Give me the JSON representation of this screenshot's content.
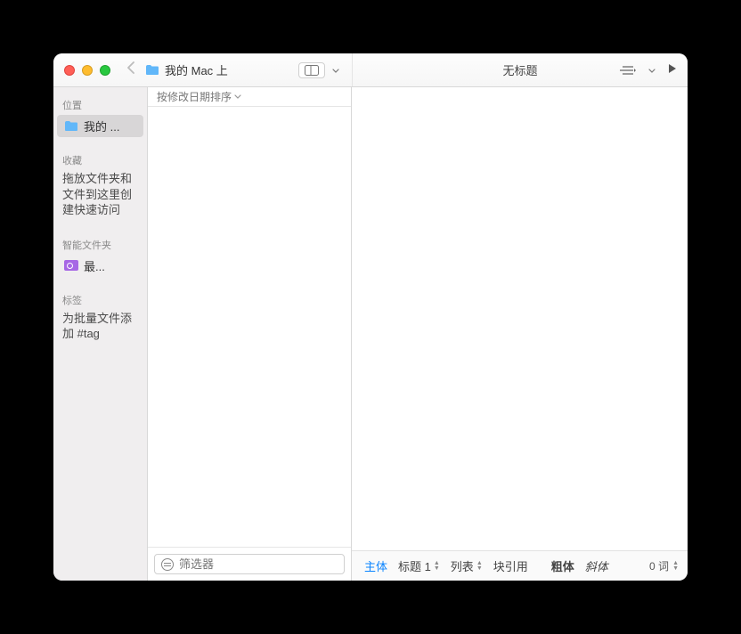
{
  "titlebar": {
    "location": "我的 Mac 上",
    "document_title": "无标题"
  },
  "sidebar": {
    "sections": {
      "location": {
        "header": "位置",
        "item": "我的 ..."
      },
      "favorites": {
        "header": "收藏",
        "hint": "拖放文件夹和文件到这里创建快速访问"
      },
      "smart": {
        "header": "智能文件夹",
        "item": "最..."
      },
      "tags": {
        "header": "标签",
        "hint": "为批量文件添加 #tag"
      }
    }
  },
  "list": {
    "sort_label": "按修改日期排序",
    "filter_placeholder": "筛选器"
  },
  "footer": {
    "body": "主体",
    "heading": "标题 1",
    "list": "列表",
    "quote": "块引用",
    "bold": "粗体",
    "italic": "斜体",
    "wordcount": "0 词"
  }
}
